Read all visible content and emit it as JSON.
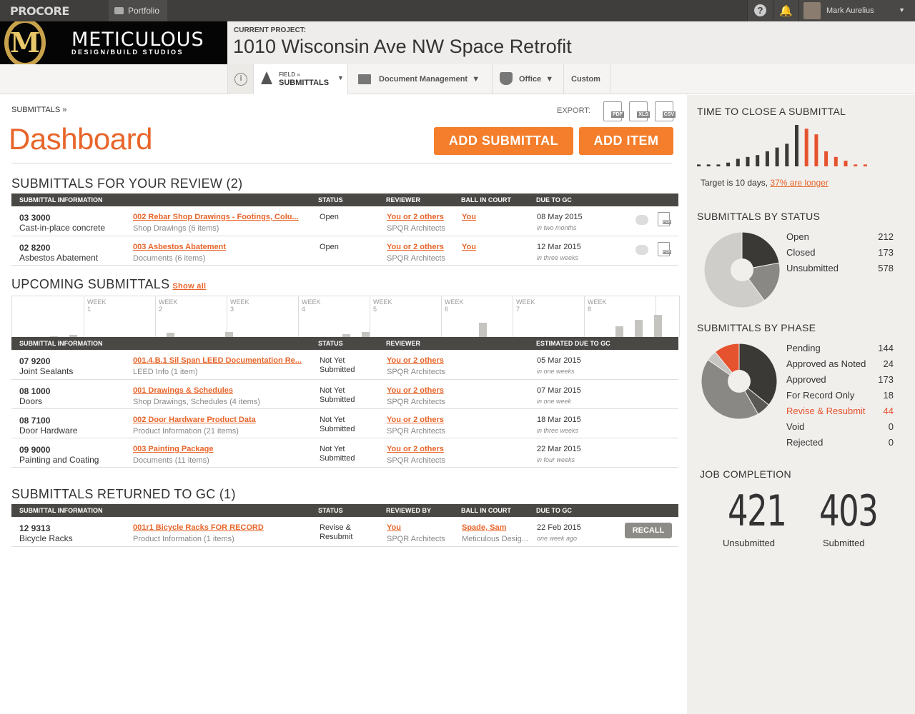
{
  "topbar": {
    "logo": "PROCORE",
    "portfolio": "Portfolio",
    "help": "?",
    "bell": "🔔",
    "user": "Mark Aurelius"
  },
  "brand": {
    "name": "METICULOUS",
    "tagline": "DESIGN/BUILD STUDIOS",
    "monogram": "M"
  },
  "project": {
    "label": "CURRENT PROJECT:",
    "name": "1010 Wisconsin Ave NW Space Retrofit"
  },
  "tabs": {
    "field_small": "FIELD »",
    "field": "SUBMITTALS",
    "doc": "Document Management",
    "office": "Office",
    "custom": "Custom"
  },
  "page": {
    "breadcrumb": "SUBMITTALS »",
    "title": "Dashboard",
    "export_label": "EXPORT:",
    "export_formats": [
      "PDF",
      "XLS",
      "CSV"
    ],
    "add_submittal": "ADD SUBMITTAL",
    "add_item": "ADD ITEM"
  },
  "review": {
    "title": "SUBMITTALS FOR YOUR REVIEW (2)",
    "headers": [
      "SUBMITTAL INFORMATION",
      "STATUS",
      "REVIEWER",
      "BALL IN COURT",
      "DUE TO GC"
    ],
    "rows": [
      {
        "code": "03 3000",
        "desc": "Cast-in-place concrete",
        "link": "002 Rebar Shop Drawings - Footings, Colu...",
        "sub": "Shop Drawings (6 items)",
        "status": "Open",
        "reviewer": "You or 2 others",
        "firm": "SPQR Architects",
        "bic": "You",
        "date": "08 May 2015",
        "rel": "in two months"
      },
      {
        "code": "02 8200",
        "desc": "Asbestos Abatement",
        "link": "003 Asbestos Abatement",
        "sub": "Documents (6 items)",
        "status": "Open",
        "reviewer": "You or 2 others",
        "firm": "SPQR Architects",
        "bic": "You",
        "date": "12 Mar 2015",
        "rel": "in three weeks"
      }
    ]
  },
  "upcoming": {
    "title": "UPCOMING SUBMITTALS",
    "show_all": "Show all",
    "weeks": [
      "WEEK 1",
      "WEEK 2",
      "WEEK 3",
      "WEEK 4",
      "WEEK 5",
      "WEEK 6",
      "WEEK 7",
      "WEEK 8"
    ],
    "week_bars": [
      1,
      3,
      6,
      7,
      4,
      7,
      20,
      15,
      24,
      31
    ],
    "headers": [
      "SUBMITTAL INFORMATION",
      "STATUS",
      "REVIEWER",
      "ESTIMATED DUE TO GC"
    ],
    "rows": [
      {
        "code": "07 9200",
        "desc": "Joint Sealants",
        "link": "001.4.B.1 Sil Span LEED Documentation Re...",
        "sub": "LEED Info (1 item)",
        "status1": "Not Yet",
        "status2": "Submitted",
        "reviewer": "You or 2 others",
        "firm": "SPQR Architects",
        "date": "05 Mar 2015",
        "rel": "in one weeks"
      },
      {
        "code": "08 1000",
        "desc": "Doors",
        "link": "001 Drawings & Schedules",
        "sub": "Shop Drawings, Schedules (4 items)",
        "status1": "Not Yet",
        "status2": "Submitted",
        "reviewer": "You or 2 others",
        "firm": "SPQR Architects",
        "date": "07 Mar 2015",
        "rel": "in one week"
      },
      {
        "code": "08 7100",
        "desc": "Door Hardware",
        "link": "002 Door Hardware Product Data",
        "sub": "Product Information (21 items)",
        "status1": "Not Yet",
        "status2": "Submitted",
        "reviewer": "You or 2 others",
        "firm": "SPQR Architects",
        "date": "18 Mar 2015",
        "rel": "in three weeks"
      },
      {
        "code": "09 9000",
        "desc": "Painting and Coating",
        "link": "003 Painting Package",
        "sub": "Documents (11 items)",
        "status1": "Not Yet",
        "status2": "Submitted",
        "reviewer": "You or 2 others",
        "firm": "SPQR Architects",
        "date": "22 Mar 2015",
        "rel": "in four weeks"
      }
    ]
  },
  "returned": {
    "title": "SUBMITTALS RETURNED TO GC (1)",
    "headers": [
      "SUBMITTAL INFORMATION",
      "STATUS",
      "REVIEWED BY",
      "BALL IN COURT",
      "DUE TO GC"
    ],
    "rows": [
      {
        "code": "12 9313",
        "desc": "Bicycle Racks",
        "link": "001r1 Bicycle Racks FOR RECORD",
        "sub": "Product Information (1 items)",
        "status1": "Revise &",
        "status2": "Resubmit",
        "reviewer": "You",
        "firm": "SPQR Architects",
        "bic": "Spade, Sam",
        "bic2": "Meticulous Desig...",
        "date": "22 Feb 2015",
        "rel": "one week ago",
        "action": "RECALL"
      }
    ]
  },
  "sidebar": {
    "ttc_title": "TIME TO CLOSE A SUBMITTAL",
    "ttc_target": "Target is 10 days,",
    "ttc_longer": "37% are longer",
    "status_title": "SUBMITTALS BY STATUS",
    "phase_title": "SUBMITTALS BY PHASE",
    "jc_title": "JOB COMPLETION",
    "jc_unsub": "421",
    "jc_unsub_label": "Unsubmitted",
    "jc_sub": "403",
    "jc_sub_label": "Submitted"
  },
  "chart_data": [
    {
      "type": "bar",
      "title": "TIME TO CLOSE A SUBMITTAL",
      "values": [
        1,
        1,
        1,
        2,
        4,
        5,
        6,
        8,
        10,
        12,
        22,
        20,
        17,
        8,
        5,
        3,
        1,
        1
      ],
      "highlight_from_index": 11,
      "colors": {
        "normal": "#3a3936",
        "over_target": "#e5532e"
      }
    },
    {
      "type": "pie",
      "title": "SUBMITTALS BY STATUS",
      "labels": [
        "Open",
        "Closed",
        "Unsubmitted"
      ],
      "values": [
        212,
        173,
        578
      ],
      "colors": [
        "#3a3936",
        "#8a8885",
        "#cfcdca"
      ]
    },
    {
      "type": "pie",
      "title": "SUBMITTALS BY PHASE",
      "labels": [
        "Pending",
        "Approved as Noted",
        "Approved",
        "For Record Only",
        "Revise & Resubmit",
        "Void",
        "Rejected"
      ],
      "values": [
        144,
        24,
        173,
        18,
        44,
        0,
        0
      ],
      "colors": [
        "#3a3936",
        "#5a5855",
        "#8a8885",
        "#c8c6c3",
        "#e5532e",
        "#999",
        "#999"
      ],
      "highlight_label": "Revise & Resubmit"
    }
  ]
}
